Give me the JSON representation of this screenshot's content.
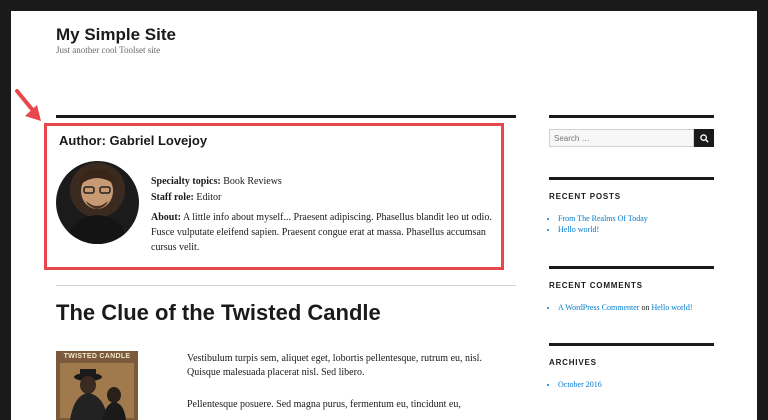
{
  "site": {
    "title": "My Simple Site",
    "tagline": "Just another cool Toolset site"
  },
  "author": {
    "heading": "Author: Gabriel Lovejoy",
    "specialty_label": "Specialty topics:",
    "specialty_value": "Book Reviews",
    "role_label": "Staff role:",
    "role_value": "Editor",
    "about_label": "About:",
    "about_text": "A little info about myself... Praesent adipiscing. Phasellus blandit leo ut odio. Fusce vulputate eleifend sapien. Praesent congue erat at massa. Phasellus accumsan cursus velit."
  },
  "post": {
    "title": "The Clue of the Twisted Candle",
    "book_cover_text": "TWISTED CANDLE",
    "paragraph1": "Vestibulum turpis sem, aliquet eget, lobortis pellentesque, rutrum eu, nisl. Quisque malesuada placerat nisl. Sed libero.",
    "paragraph2": "Pellentesque posuere. Sed magna purus, fermentum eu, tincidunt eu,"
  },
  "sidebar": {
    "search_placeholder": "Search …",
    "recent_posts_title": "RECENT POSTS",
    "recent_posts": [
      "From The Realms Of Today",
      "Hello world!"
    ],
    "recent_comments_title": "RECENT COMMENTS",
    "comment_author": "A WordPress Commenter",
    "comment_on": "on",
    "comment_post": "Hello world!",
    "archives_title": "ARCHIVES",
    "archives": [
      "October 2016"
    ]
  },
  "colors": {
    "highlight": "#e8474d",
    "link": "#007acc"
  }
}
